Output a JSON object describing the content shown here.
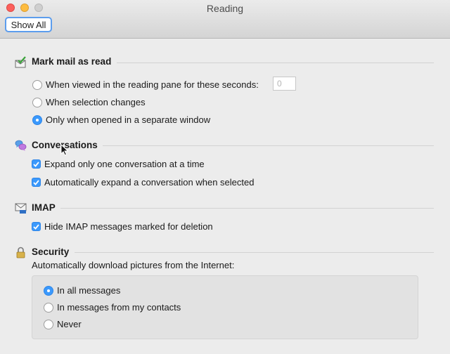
{
  "window": {
    "title": "Reading",
    "show_all_label": "Show All"
  },
  "mark_read": {
    "title": "Mark mail as read",
    "opt_reading_pane": "When viewed in the reading pane for these seconds:",
    "seconds_value": "0",
    "opt_selection_changes": "When selection changes",
    "opt_separate_window": "Only when opened in a separate window",
    "selected": "opt_separate_window"
  },
  "conversations": {
    "title": "Conversations",
    "expand_one": "Expand only one conversation at a time",
    "expand_one_checked": true,
    "auto_expand": "Automatically expand a conversation when selected",
    "auto_expand_checked": true
  },
  "imap": {
    "title": "IMAP",
    "hide_deleted": "Hide IMAP messages marked for deletion",
    "hide_deleted_checked": true
  },
  "security": {
    "title": "Security",
    "download_label": "Automatically download pictures from the Internet:",
    "opt_all": "In all messages",
    "opt_contacts": "In messages from my contacts",
    "opt_never": "Never",
    "selected": "opt_all"
  },
  "icons": {
    "mark_read": "envelope-check-icon",
    "conversations": "speech-bubbles-icon",
    "imap": "imap-envelope-icon",
    "security": "padlock-icon"
  },
  "colors": {
    "accent": "#3b99fc",
    "focus_ring": "#5c9ded"
  }
}
